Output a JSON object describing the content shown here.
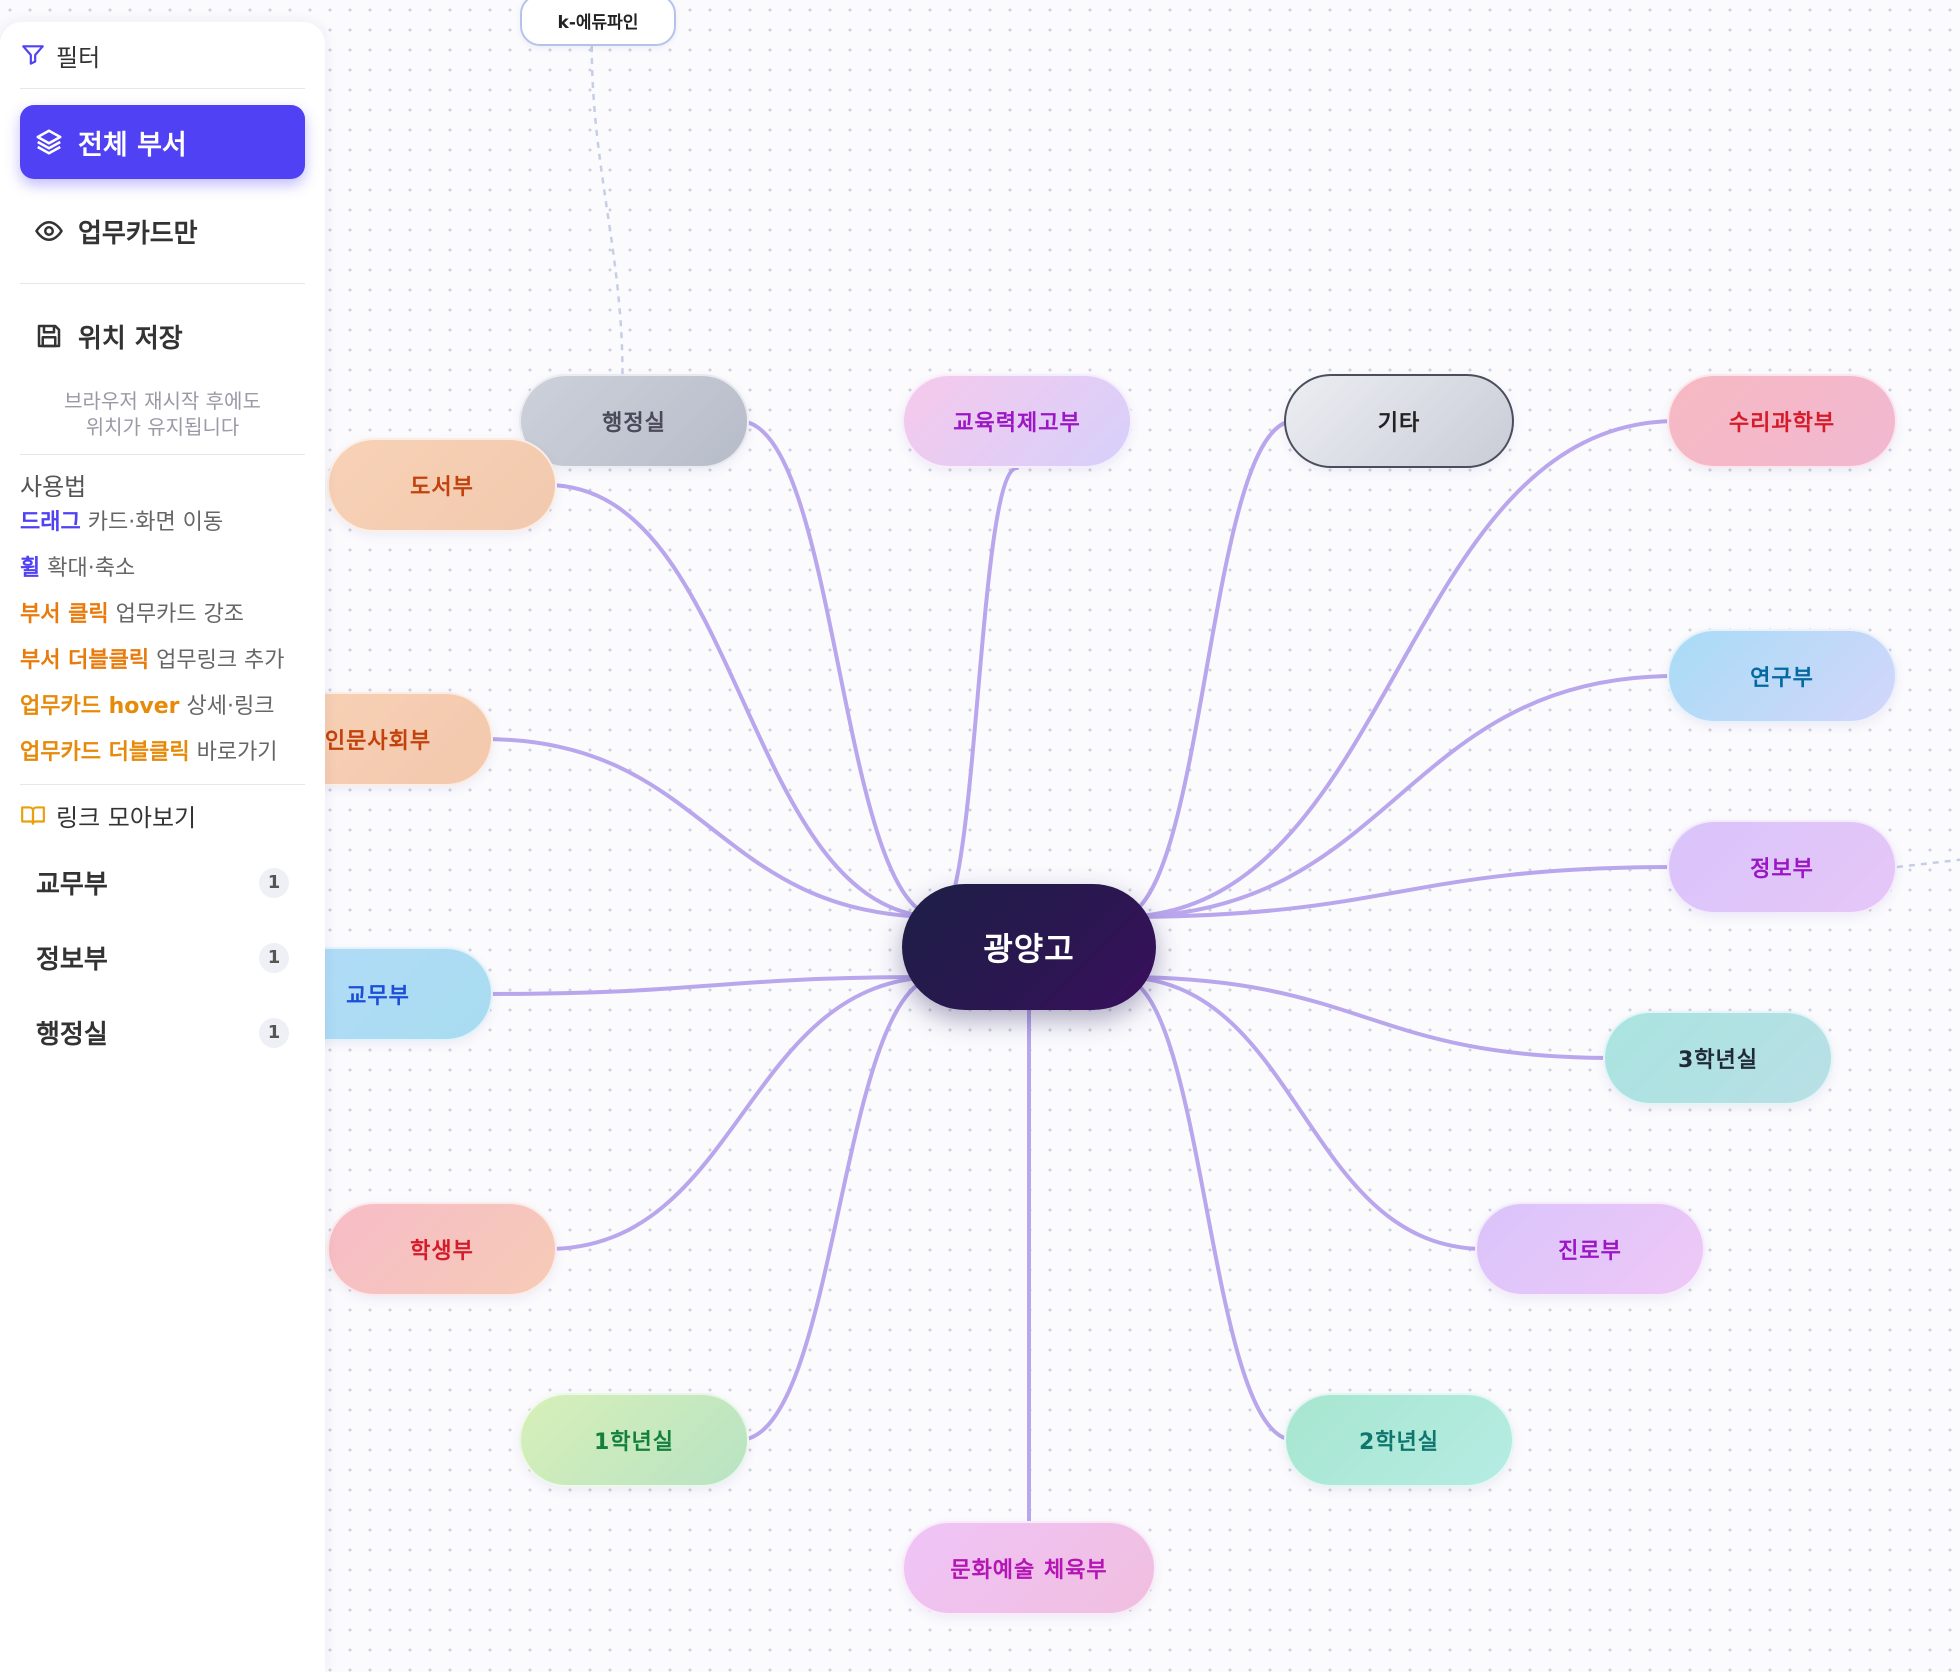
{
  "sidebar": {
    "filter_label": "필터",
    "btn_all": "전체 부서",
    "btn_cards_only": "업무카드만",
    "save_label": "위치 저장",
    "save_note_1": "브라우저 재시작 후에도",
    "save_note_2": "위치가 유지됩니다",
    "usage_title": "사용법",
    "usage": [
      {
        "key": "드래그",
        "text": " 카드·화면 이동"
      },
      {
        "key": "휠",
        "text": " 확대·축소"
      },
      {
        "key": "부서 클릭",
        "text": " 업무카드 강조"
      },
      {
        "key": "부서 더블클릭",
        "text": " 업무링크 추가"
      },
      {
        "key": "업무카드 hover",
        "text": " 상세·링크"
      },
      {
        "key": "업무카드 더블클릭",
        "text": " 바로가기"
      }
    ],
    "links_title": "링크 모아보기",
    "link_groups": [
      {
        "name": "교무부",
        "count": "1"
      },
      {
        "name": "정보부",
        "count": "1"
      },
      {
        "name": "행정실",
        "count": "1"
      }
    ]
  },
  "map": {
    "center": "광양고",
    "link_card": "k-에듀파인",
    "edge_color": "#b9a6ec",
    "nodes": [
      {
        "id": "haengjeong",
        "label": "행정실",
        "color": "#4a4a5a"
      },
      {
        "id": "gyoyuk",
        "label": "교육력제고부",
        "color": "#9b16c4"
      },
      {
        "id": "gita",
        "label": "기타",
        "color": "#222222"
      },
      {
        "id": "suri",
        "label": "수리과학부",
        "color": "#d51b2a"
      },
      {
        "id": "doseo",
        "label": "도서부",
        "color": "#c2410c"
      },
      {
        "id": "yeongu",
        "label": "연구부",
        "color": "#0369a1"
      },
      {
        "id": "inmun",
        "label": "인문사회부",
        "color": "#c2410c"
      },
      {
        "id": "jeongbo",
        "label": "정보부",
        "color": "#9b16c4"
      },
      {
        "id": "gyomu",
        "label": "교무부",
        "color": "#1d4ed8"
      },
      {
        "id": "hak3",
        "label": "3학년실",
        "color": "#1f2937"
      },
      {
        "id": "haksaeng",
        "label": "학생부",
        "color": "#d51b2a"
      },
      {
        "id": "jinro",
        "label": "진로부",
        "color": "#9b16c4"
      },
      {
        "id": "hak1",
        "label": "1학년실",
        "color": "#15803d"
      },
      {
        "id": "hak2",
        "label": "2학년실",
        "color": "#0f766e"
      },
      {
        "id": "munhwa",
        "label": "문화예술 체육부",
        "color": "#b515b5"
      }
    ]
  }
}
